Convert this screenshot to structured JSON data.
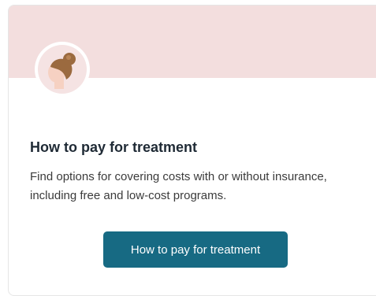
{
  "card": {
    "title": "How to pay for treatment",
    "description": "Find options for covering costs with or without insurance, including free and low-cost programs.",
    "button_label": "How to pay for treatment",
    "avatar_icon": "person-with-bun-icon"
  },
  "colors": {
    "banner": "#f3dede",
    "button": "#176a83",
    "title": "#1f2a35",
    "avatar_hair": "#9b6a3f",
    "avatar_skin": "#f6d1c2"
  }
}
